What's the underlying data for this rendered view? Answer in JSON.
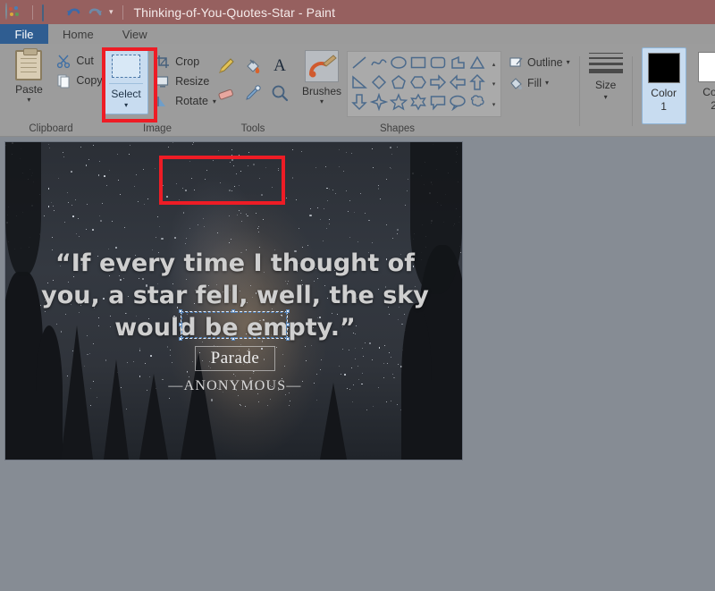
{
  "window": {
    "title": "Thinking-of-You-Quotes-Star - Paint",
    "app_icon": "paint-palette-icon",
    "quick_access": [
      {
        "name": "save-icon",
        "label": "Save"
      },
      {
        "name": "undo-icon",
        "label": "Undo"
      },
      {
        "name": "redo-icon",
        "label": "Redo"
      },
      {
        "name": "customize-quick-access-caret",
        "label": "▾"
      }
    ]
  },
  "tabs": [
    {
      "label": "File",
      "active": true
    },
    {
      "label": "Home",
      "active": false
    },
    {
      "label": "View",
      "active": false
    }
  ],
  "ribbon": {
    "groups": [
      {
        "label": "Clipboard",
        "paste": {
          "label": "Paste",
          "caret": "▾",
          "icon": "clipboard-icon"
        },
        "items": [
          {
            "label": "Cut",
            "icon": "scissors-icon"
          },
          {
            "label": "Copy",
            "icon": "copy-icon"
          }
        ]
      },
      {
        "label": "Image",
        "select": {
          "label": "Select",
          "caret": "▾",
          "icon": "dashed-rectangle-icon",
          "highlighted": true
        },
        "items": [
          {
            "label": "Crop",
            "icon": "crop-icon"
          },
          {
            "label": "Resize",
            "icon": "resize-icon"
          },
          {
            "label": "Rotate",
            "icon": "rotate-icon",
            "caret": "▾"
          }
        ]
      },
      {
        "label": "Tools",
        "tools": [
          {
            "name": "pencil-icon"
          },
          {
            "name": "fill-with-color-icon"
          },
          {
            "name": "text-icon"
          },
          {
            "name": "eraser-icon"
          },
          {
            "name": "color-picker-icon"
          },
          {
            "name": "magnifier-icon"
          }
        ]
      },
      {
        "label": "Shapes",
        "brushes": {
          "label": "Brushes",
          "caret": "▾",
          "icon": "brush-icon"
        },
        "shape_names": [
          "line-shape",
          "curve-shape",
          "oval-shape",
          "rectangle-shape",
          "rounded-rectangle-shape",
          "polygon-shape",
          "triangle-shape",
          "right-triangle-shape",
          "diamond-shape",
          "pentagon-shape",
          "hexagon-shape",
          "right-arrow-shape",
          "left-arrow-shape",
          "up-arrow-shape",
          "down-arrow-shape",
          "four-point-star-shape",
          "five-point-star-shape",
          "six-point-star-shape",
          "rounded-callout-shape",
          "oval-callout-shape",
          "cloud-callout-shape"
        ],
        "scroll": {
          "up": "▴",
          "more": "▾",
          "expand": "▾"
        }
      },
      {
        "label": "",
        "outline": {
          "label": "Outline",
          "caret": "▾",
          "icon": "outline-icon"
        },
        "fill": {
          "label": "Fill",
          "caret": "▾",
          "icon": "fill-icon"
        },
        "size": {
          "label": "Size",
          "caret": "▾",
          "icon": "size-lines-icon"
        },
        "color1": {
          "label": "Color",
          "sub": "1",
          "swatch": "#000000",
          "selected": true
        },
        "color2": {
          "label": "Colo",
          "sub": "2",
          "swatch": "#ffffff",
          "selected": false
        }
      }
    ]
  },
  "canvas": {
    "quote": "“If every time I thought of you, a star fell, well, the sky would be empty.”",
    "attribution": "—ANONYMOUS—",
    "watermark": "Parade",
    "selection": {
      "name": "selection-marquee",
      "visible": true
    }
  },
  "annotations": [
    {
      "name": "highlight-select-tool",
      "color": "#ee1c25"
    },
    {
      "name": "highlight-selection-region",
      "color": "#ee1c25"
    }
  ],
  "colors": {
    "titlebar": "#96605f",
    "ribbon": "#9c9c9c",
    "file_tab": "#2f5d91",
    "workspace": "#868c94",
    "annotation": "#ee1c25",
    "highlight": "#c8dcf0"
  }
}
